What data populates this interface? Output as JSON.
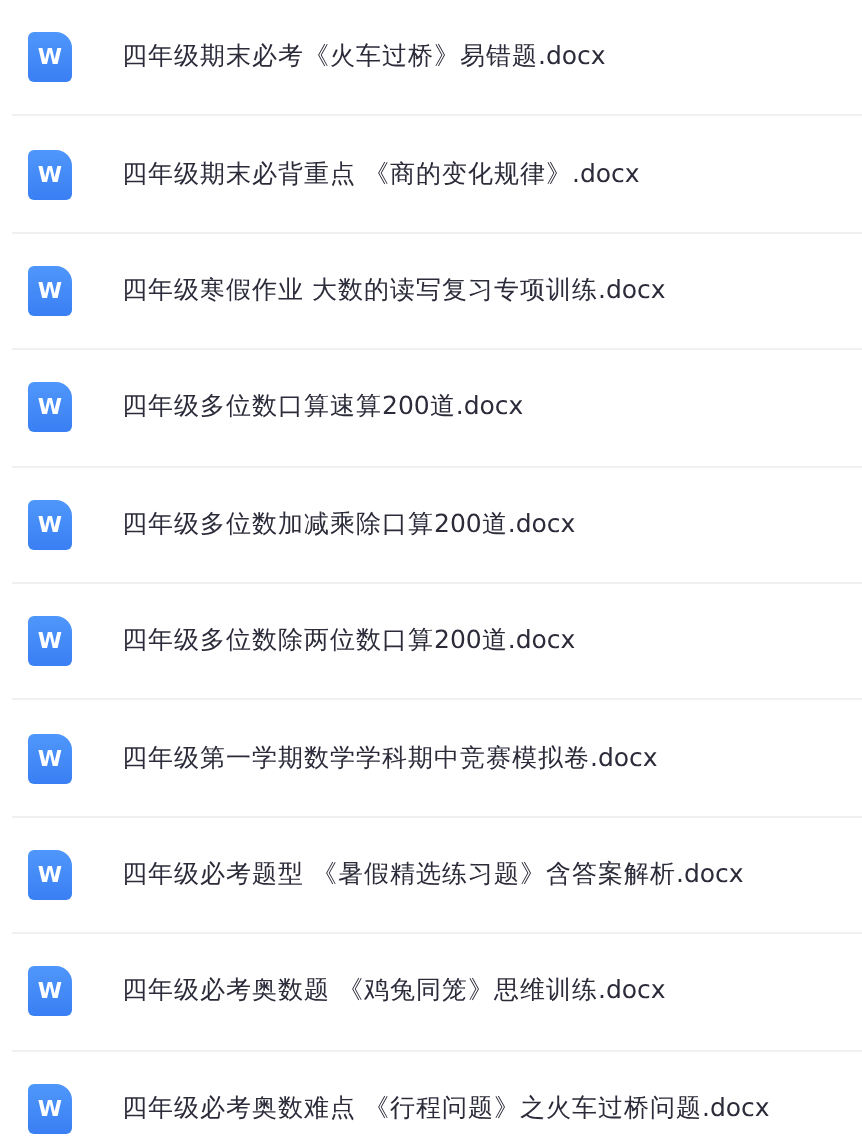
{
  "files": [
    {
      "name": "四年级期末必考《火车过桥》易错题.docx",
      "icon_label": "W"
    },
    {
      "name": "四年级期末必背重点 《商的变化规律》.docx",
      "icon_label": "W"
    },
    {
      "name": "四年级寒假作业 大数的读写复习专项训练.docx",
      "icon_label": "W"
    },
    {
      "name": "四年级多位数口算速算200道.docx",
      "icon_label": "W"
    },
    {
      "name": "四年级多位数加减乘除口算200道.docx",
      "icon_label": "W"
    },
    {
      "name": "四年级多位数除两位数口算200道.docx",
      "icon_label": "W"
    },
    {
      "name": "四年级第一学期数学学科期中竞赛模拟卷.docx",
      "icon_label": "W"
    },
    {
      "name": "四年级必考题型 《暑假精选练习题》含答案解析.docx",
      "icon_label": "W"
    },
    {
      "name": "四年级必考奥数题 《鸡兔同笼》思维训练.docx",
      "icon_label": "W"
    },
    {
      "name": "四年级必考奥数难点 《行程问题》之火车过桥问题.docx",
      "icon_label": "W"
    }
  ]
}
